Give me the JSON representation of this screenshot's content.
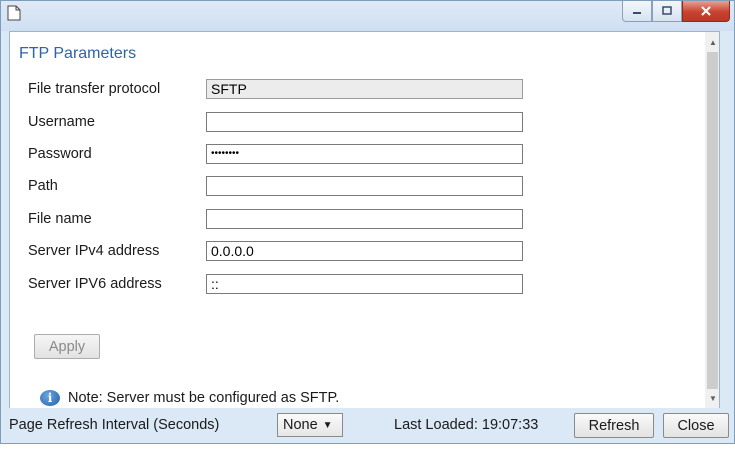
{
  "window": {
    "doc_icon": "document-icon"
  },
  "section": {
    "title": "FTP Parameters"
  },
  "form": {
    "fields": [
      {
        "label": "File transfer protocol",
        "value": "SFTP",
        "disabled": true
      },
      {
        "label": "Username",
        "value": ""
      },
      {
        "label": "Password",
        "value": "••••••••"
      },
      {
        "label": "Path",
        "value": ""
      },
      {
        "label": "File name",
        "value": ""
      },
      {
        "label": "Server IPv4 address",
        "value": "0.0.0.0"
      },
      {
        "label": "Server IPV6 address",
        "value": "::"
      }
    ],
    "apply_label": "Apply"
  },
  "note": {
    "icon": "info-icon",
    "text": "Note: Server must be configured as SFTP."
  },
  "footer": {
    "refresh_interval_label": "Page Refresh Interval (Seconds)",
    "refresh_interval_value": "None",
    "last_loaded": "Last Loaded: 19:07:33",
    "refresh_label": "Refresh",
    "close_label": "Close"
  },
  "colors": {
    "accent": "#2e63a8",
    "close_button": "#c7432f",
    "window_frame": "#dbe8f6"
  }
}
